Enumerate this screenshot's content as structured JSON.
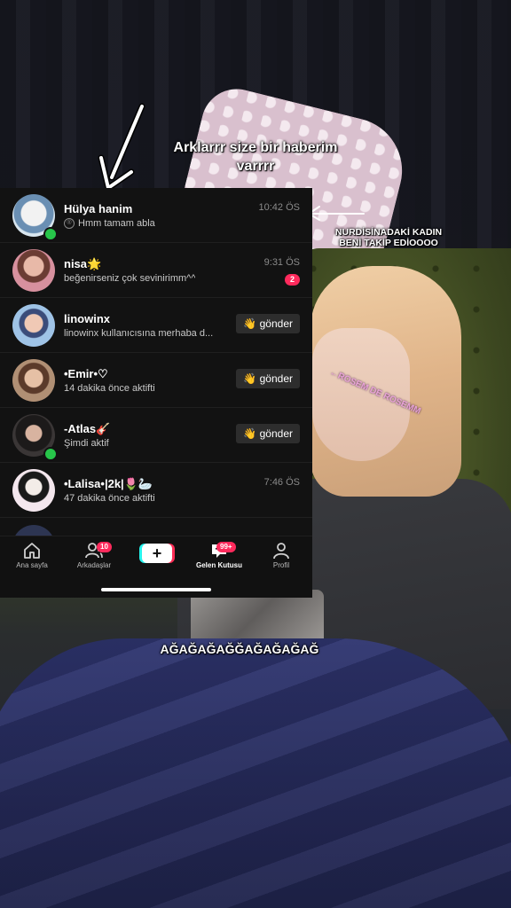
{
  "overlay": {
    "top_caption_line1": "Arklarrr size bir haberim",
    "top_caption_line2": "varrrr",
    "right_caption_line1": "NURDİSİNADAKİ KADIN",
    "right_caption_line2": "BENİ TAKİP EDİOOOO",
    "pink_caption": "←ROSEM DE ROSEMM",
    "bottom_caption": "AĞAĞAĞAĞĞAĞAĞAĞAĞ"
  },
  "inbox": {
    "rows": [
      {
        "name": "Hülya hanim",
        "subtitle": "Hmm tamam abla",
        "time": "10:42 ÖS",
        "status": "seen",
        "online": true
      },
      {
        "name": "nisa🌟",
        "subtitle": "beğenirseniz çok sevinirimm^^",
        "time": "9:31 ÖS",
        "unread": "2",
        "online": false
      },
      {
        "name": "linowinx",
        "subtitle": "linowinx kullanıcısına merhaba d...",
        "action": "👋 gönder",
        "online": false
      },
      {
        "name": "•Emir•♡",
        "subtitle": "14 dakika önce aktifti",
        "action": "👋 gönder",
        "online": false
      },
      {
        "name": "-Atlas🎸",
        "subtitle": "Şimdi aktif",
        "action": "👋 gönder",
        "online": true
      },
      {
        "name": "•Lalisa•|2k|🌷🦢",
        "subtitle": "47 dakika önce aktifti",
        "time": "7:46 ÖS",
        "online": false
      }
    ]
  },
  "tabbar": {
    "home": "Ana sayfa",
    "friends": "Arkadaşlar",
    "friends_badge": "10",
    "create": "+",
    "inbox": "Gelen Kutusu",
    "inbox_badge": "99+",
    "profile": "Profil",
    "active": "inbox"
  },
  "colors": {
    "panel_bg": "#121212",
    "badge": "#ff2a5c",
    "online": "#27c54a",
    "pink_text": "#e8a3d6"
  }
}
